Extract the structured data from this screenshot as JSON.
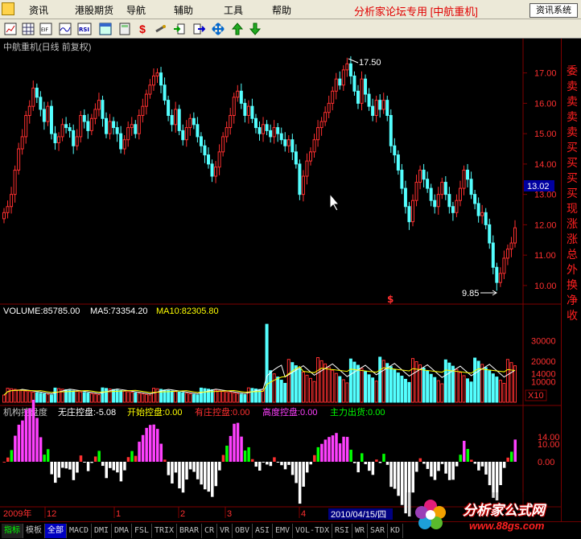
{
  "menubar": {
    "items": [
      "资讯",
      "港股期货",
      "导航",
      "辅助",
      "工具",
      "帮助"
    ],
    "brand": "分析家论坛专用 [中航重机]",
    "info_system_button": "资讯系统"
  },
  "toolbar": {
    "icons": [
      "chart-icon",
      "grid-icon",
      "eif-icon",
      "trend-icon",
      "rsi-icon",
      "window-icon",
      "calc-icon",
      "dollar-icon",
      "link-icon",
      "import-icon",
      "export-icon",
      "move-icon",
      "arrow-up-icon",
      "arrow-down-icon"
    ],
    "labels": {
      "rsi": "RSI",
      "eif": "EIF"
    }
  },
  "price_panel": {
    "title": "中航重机(日线 前复权)",
    "y_ticks": [
      "17.00",
      "16.00",
      "15.00",
      "14.00",
      "13.00",
      "12.00",
      "11.00",
      "10.00"
    ],
    "current_price": "13.02",
    "high_label": "17.50",
    "low_label": "9.85",
    "event_marker": "$"
  },
  "volume_panel": {
    "vol_label": "VOLUME:85785.00",
    "ma5_label": "MA5:73354.20",
    "ma10_label": "MA10:82305.80",
    "y_ticks": [
      "30000",
      "20000",
      "14000",
      "10000"
    ],
    "unit": "X10"
  },
  "indicator_panel": {
    "name": "机构控盘度",
    "items": [
      {
        "label": "无庄控盘:-5.08",
        "color": "#ffffff"
      },
      {
        "label": "开始控盘:0.00",
        "color": "#ffff00"
      },
      {
        "label": "有庄控盘:0.00",
        "color": "#ff3030"
      },
      {
        "label": "高度控盘:0.00",
        "color": "#ff40ff"
      },
      {
        "label": "主力出货:0.00",
        "color": "#00ff00"
      }
    ],
    "y_ticks": [
      "14.00",
      "10.00",
      "0.00"
    ]
  },
  "time_axis": {
    "year": "2009年",
    "months": [
      "12",
      "1",
      "2",
      "3",
      "4"
    ],
    "cursor_date": "2010/04/15/四"
  },
  "right_strip": {
    "chars": [
      "委",
      "卖",
      "卖",
      "卖",
      "卖",
      "买",
      "买",
      "买",
      "买",
      "现",
      "涨",
      "涨",
      "总",
      "外",
      "换",
      "净",
      "收"
    ]
  },
  "bottom_tabs": [
    "指标",
    "模板",
    "全部",
    "MACD",
    "DMI",
    "DMA",
    "FSL",
    "TRIX",
    "BRAR",
    "CR",
    "VR",
    "OBV",
    "ASI",
    "EMV",
    "VOL-TDX",
    "RSI",
    "WR",
    "SAR",
    "KD"
  ],
  "watermark": {
    "title": "分析家公式网",
    "url": "www.88gs.com"
  },
  "colors": {
    "up": "#ff3030",
    "down": "#54ffff",
    "ma5": "#ffffff",
    "ma10": "#ffff00",
    "axis": "#800000"
  },
  "chart_data": {
    "type": "candlestick",
    "title": "中航重机(日线 前复权)",
    "y_range": [
      9.6,
      17.6
    ],
    "closes": [
      12.4,
      12.6,
      13.0,
      13.8,
      14.5,
      14.9,
      15.6,
      15.9,
      16.5,
      16.2,
      15.8,
      15.4,
      15.9,
      15.0,
      14.7,
      14.9,
      15.3,
      15.2,
      15.1,
      14.6,
      14.9,
      15.6,
      15.4,
      15.1,
      15.5,
      15.8,
      16.1,
      15.5,
      15.0,
      15.4,
      15.2,
      15.0,
      14.5,
      14.8,
      15.2,
      15.3,
      15.0,
      15.6,
      15.9,
      16.3,
      16.6,
      16.9,
      17.0,
      16.6,
      16.1,
      15.6,
      15.3,
      15.8,
      15.1,
      14.8,
      15.2,
      15.5,
      15.3,
      14.9,
      14.6,
      14.3,
      14.0,
      13.6,
      13.9,
      14.4,
      14.9,
      15.2,
      15.6,
      16.2,
      16.4,
      16.0,
      15.6,
      15.9,
      15.5,
      15.2,
      15.0,
      15.3,
      15.1,
      14.9,
      15.2,
      15.0,
      14.8,
      14.6,
      14.8,
      14.4,
      14.0,
      13.0,
      13.6,
      14.1,
      14.4,
      14.8,
      15.2,
      15.4,
      15.7,
      16.0,
      16.4,
      16.8,
      16.6,
      17.1,
      17.3,
      16.9,
      16.4,
      16.0,
      16.8,
      16.3,
      15.9,
      15.6,
      16.1,
      15.8,
      16.1,
      15.6,
      14.6,
      14.3,
      13.8,
      13.2,
      12.6,
      12.1,
      12.8,
      13.4,
      13.8,
      13.5,
      13.2,
      12.8,
      12.6,
      13.0,
      13.4,
      13.0,
      12.6,
      12.4,
      12.8,
      13.2,
      13.8,
      13.5,
      13.0,
      12.7,
      12.3,
      12.4,
      12.0,
      11.4,
      10.6,
      10.1,
      10.4,
      10.9,
      11.2,
      11.4,
      11.9
    ],
    "volume_y_ticks": [
      10000,
      14000,
      20000,
      30000
    ],
    "volume_peak": 40000,
    "volume_breakout_index": 72,
    "indicator_y_ticks": [
      0,
      10,
      14
    ]
  }
}
